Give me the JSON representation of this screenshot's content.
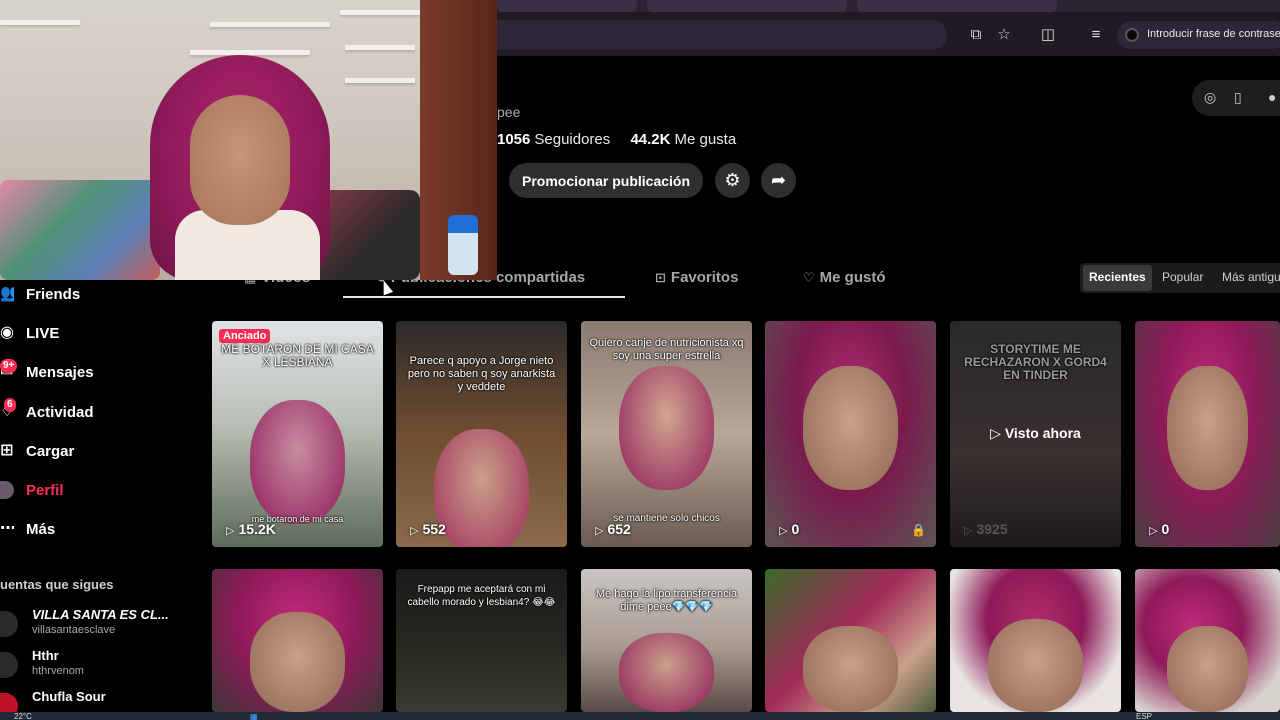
{
  "browser": {
    "password_chip_label": "Introducir frase de contrase"
  },
  "profile": {
    "username_tail": "pee",
    "followers_count": "1056",
    "followers_label": "Seguidores",
    "likes_count": "44.2K",
    "likes_label": "Me gusta",
    "promote_label": "Promocionar publicación"
  },
  "tabs": [
    {
      "label": "Videos",
      "icon": "grid-icon"
    },
    {
      "label": "Publicaciones compartidas",
      "icon": "repost-icon"
    },
    {
      "label": "Favoritos",
      "icon": "bookmark-icon"
    },
    {
      "label": "Me gustó",
      "icon": "heart-icon"
    }
  ],
  "sort": {
    "recent": "Recientes",
    "popular": "Popular",
    "oldest": "Más antigu"
  },
  "sidebar": {
    "items": [
      {
        "label": "Friends",
        "icon": "friends-icon"
      },
      {
        "label": "LIVE",
        "icon": "live-icon"
      },
      {
        "label": "Mensajes",
        "icon": "messages-icon",
        "badge": "9+"
      },
      {
        "label": "Actividad",
        "icon": "activity-icon",
        "badge": "6"
      },
      {
        "label": "Cargar",
        "icon": "upload-icon"
      },
      {
        "label": "Perfil",
        "icon": "profile-icon",
        "active": true
      },
      {
        "label": "Más",
        "icon": "more-icon"
      }
    ],
    "following_title": "uentas que sigues",
    "accounts": [
      {
        "name": "VILLA SANTA ES CL...",
        "handle": "villasantaesclave"
      },
      {
        "name": "Hthr",
        "handle": "hthrvenom"
      },
      {
        "name": "Chufla Sour",
        "handle": ""
      }
    ]
  },
  "videos_row1": [
    {
      "pinned_label": "Anciado",
      "caption": "ME BOTARON DE MI CASA X LESBIANA",
      "views": "15.2K",
      "sub": "me botaron de mi casa"
    },
    {
      "caption": "Parece q apoyo a Jorge nieto pero no saben q soy anarkista y veddete",
      "views": "552"
    },
    {
      "caption": "Quiero canje de nutricionista xq soy una super estrella",
      "views": "652",
      "sub": "se mantiene solo chicos"
    },
    {
      "caption": "",
      "views": "0",
      "locked": true
    },
    {
      "caption": "STORYTIME ME RECHAZARON X GORD4 EN TINDER",
      "views": "3925",
      "watched": "Visto ahora"
    },
    {
      "caption": "",
      "views": "0"
    }
  ],
  "videos_row2": [
    {
      "caption": ""
    },
    {
      "caption": "Frepapp me aceptará con mi cabello morado y lesbian4? 😂😂"
    },
    {
      "caption": "Me hago la lipo transferencia dime peee💎💎💎"
    },
    {
      "caption": ""
    },
    {
      "caption": ""
    },
    {
      "caption": ""
    }
  ],
  "taskbar": {
    "temp": "22°C",
    "lang": "ESP"
  }
}
